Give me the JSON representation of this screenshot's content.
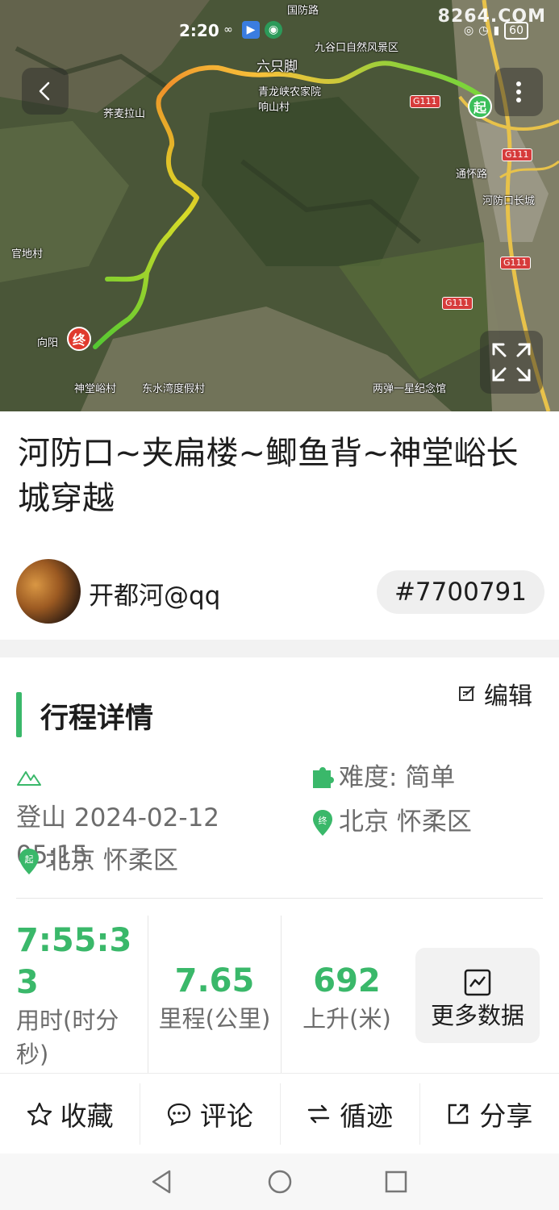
{
  "status_bar": {
    "time": "2:20",
    "battery": "60",
    "watermark": "8264.COM"
  },
  "map": {
    "labels": {
      "a": "国防路",
      "b": "九谷口自然风景区",
      "c": "六只脚",
      "d": "青龙峡农家院响山村",
      "e": "荞麦拉山",
      "f": "通怀路",
      "g": "河防口长城",
      "h": "官地村",
      "i": "向阳",
      "j": "神堂峪村",
      "k": "东水湾度假村",
      "l": "两弹一星纪念馆"
    },
    "roads": [
      "G111",
      "G111",
      "G111",
      "G111"
    ],
    "start_pin": "起",
    "end_pin": "终",
    "icons": {
      "back": "chevron-left-icon",
      "more": "more-vertical-icon",
      "expand": "expand-icon"
    }
  },
  "trip": {
    "title": "河防口~夹扁楼~鲫鱼背~神堂峪长城穿越",
    "author": "开都河@qq",
    "track_id": "#7700791"
  },
  "details": {
    "section_title": "行程详情",
    "edit_label": "编辑",
    "activity_date": "登山 2024-02-12 05:15",
    "difficulty": "难度: 简单",
    "end_location": "北京 怀柔区",
    "start_location": "北京 怀柔区",
    "start_badge": "起",
    "end_badge": "终"
  },
  "stats": {
    "duration": {
      "value": "7:55:33",
      "label": "用时(时分秒)"
    },
    "distance": {
      "value": "7.65",
      "label": "里程(公里)"
    },
    "ascent": {
      "value": "692",
      "label": "上升(米)"
    },
    "more_label": "更多数据"
  },
  "actions": [
    {
      "label": "收藏",
      "icon": "star-icon"
    },
    {
      "label": "评论",
      "icon": "comment-icon"
    },
    {
      "label": "循迹",
      "icon": "follow-track-icon"
    },
    {
      "label": "分享",
      "icon": "share-icon"
    }
  ],
  "colors": {
    "accent": "#3ab86a",
    "start_pin": "#3bbf5a",
    "end_pin": "#e03a2e",
    "road": "#d63b3b"
  }
}
